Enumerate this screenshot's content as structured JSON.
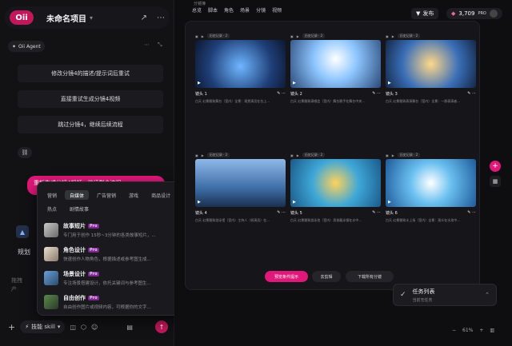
{
  "header": {
    "logo": "Oii",
    "project_title": "未命名项目"
  },
  "agent": {
    "tag": "Oii Agent"
  },
  "options": [
    "修改分镜4的描述/提示词后重试",
    "直接重试生成分镜4视频",
    "跳过分镜4，继续后续流程"
  ],
  "user_message": "重新生成分镜4视频，继续剩余流程",
  "plan_text": "规划",
  "prompt_placeholder": "拖拽产",
  "skill_chip": "技能 skill",
  "popup": {
    "categories_row1": [
      "营销",
      "自媒体",
      "广告营销",
      "游戏",
      "商品设计"
    ],
    "categories_row2": [
      "热点",
      "剧情故事"
    ],
    "items": [
      {
        "title": "故事短片",
        "badge": "Pro",
        "desc": "专门用于创作 15秒~3分钟的各类故事短片，..."
      },
      {
        "title": "角色设计",
        "badge": "Pro",
        "desc": "快速创作人物角色，根据描述或参考图生成..."
      },
      {
        "title": "场景设计",
        "badge": "Pro",
        "desc": "专注场景搭建设计，依托关键词与参考图生..."
      },
      {
        "title": "自由创作",
        "badge": "Pro",
        "desc": "自由创作图片或视频内容，可根据你的文字..."
      }
    ]
  },
  "canvas": {
    "nav_label": "分镜簿",
    "tabs": [
      "总览",
      "脚本",
      "角色",
      "场景",
      "分镜",
      "视频"
    ],
    "publish": "发布",
    "credits": "3,709",
    "pro": "PRO",
    "cards": [
      {
        "head": "历史记录 · 2",
        "title": "镜头 1",
        "desc": "白天 幻景雅致舞台（室内）全景：观赏演员在台上..."
      },
      {
        "head": "历史记录 · 2",
        "title": "镜头 2",
        "desc": "白天 幻景雅致演唱会（室内）舞台歌手在舞台中央..."
      },
      {
        "head": "历史记录 · 2",
        "title": "镜头 3",
        "desc": "白天 幻景雅致表演舞台（室内）全景：一群表演者..."
      },
      {
        "head": "历史记录 · 2",
        "title": "镜头 4",
        "desc": "白天 幻景雅致游泳馆（室内）主持人（如演员）在..."
      },
      {
        "head": "历史记录 · 2",
        "title": "镜头 5",
        "desc": "白天 幻景雅致游泳池（室内）男孩戴泳镜在水中..."
      },
      {
        "head": "历史记录 · 2",
        "title": "镜头 6",
        "desc": "白天 幻景雅致水上场（室内）全景：观众在水池中..."
      }
    ],
    "generate_btn": "预览条件提示",
    "edit_btn": "去剪辑",
    "download_btn": "下载所有分镜",
    "tasks_title": "任务列表",
    "tasks_sub": "当前无任务",
    "zoom": "61%"
  }
}
